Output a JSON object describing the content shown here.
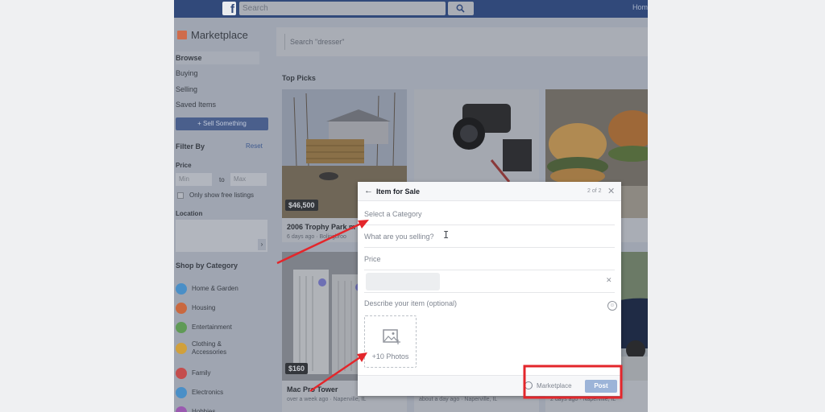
{
  "topbar": {
    "search_placeholder": "Search",
    "home": "Hom"
  },
  "sidebar": {
    "title": "Marketplace",
    "nav": [
      {
        "label": "Browse"
      },
      {
        "label": "Buying"
      },
      {
        "label": "Selling"
      },
      {
        "label": "Saved Items"
      }
    ],
    "sell_button": "+ Sell Something",
    "filter_by": "Filter By",
    "reset": "Reset",
    "price": "Price",
    "min_placeholder": "Min",
    "to": "to",
    "max_placeholder": "Max",
    "free_only": "Only show free listings",
    "location": "Location",
    "location_handle": "›",
    "shop_by_category": "Shop by Category",
    "categories": [
      {
        "label": "Home & Garden",
        "color": "#4a8fc7"
      },
      {
        "label": "Housing",
        "color": "#c9683f"
      },
      {
        "label": "Entertainment",
        "color": "#5f9a56"
      },
      {
        "label": "Clothing & Accessories",
        "color": "#d1a03b"
      },
      {
        "label": "Family",
        "color": "#c44d4d"
      },
      {
        "label": "Electronics",
        "color": "#4a8fc7"
      },
      {
        "label": "Hobbies",
        "color": "#9a5ab0"
      }
    ]
  },
  "main": {
    "search_placeholder": "Search \"dresser\"",
    "top_picks": "Top Picks",
    "cards": [
      {
        "price": "$46,500",
        "title": "2006 Trophy Park m",
        "meta": "6 days ago · Bolingbroo"
      },
      {
        "price": "",
        "title": "",
        "meta": ""
      },
      {
        "price": "",
        "title": "",
        "meta": ""
      },
      {
        "price": "$160",
        "title": "Mac Pro Tower",
        "meta": "over a week ago · Naperville, IL"
      },
      {
        "price": "",
        "title": "",
        "meta": "about a day ago · Naperville, IL"
      },
      {
        "price": "",
        "title": "",
        "meta": "2 days ago · Naperville, IL"
      }
    ]
  },
  "modal": {
    "back": "←",
    "title": "Item for Sale",
    "step": "2 of 2",
    "close": "✕",
    "category_placeholder": "Select a Category",
    "what_placeholder": "What are you selling?",
    "price_placeholder": "Price",
    "location_clear": "✕",
    "description_placeholder": "Describe your item (optional)",
    "photos_label": "+10 Photos",
    "audience": "Marketplace",
    "post": "Post"
  },
  "colors": {
    "annotation_red": "#e3262b",
    "topbar": "#31497a",
    "post_button": "#9cb4d8"
  }
}
